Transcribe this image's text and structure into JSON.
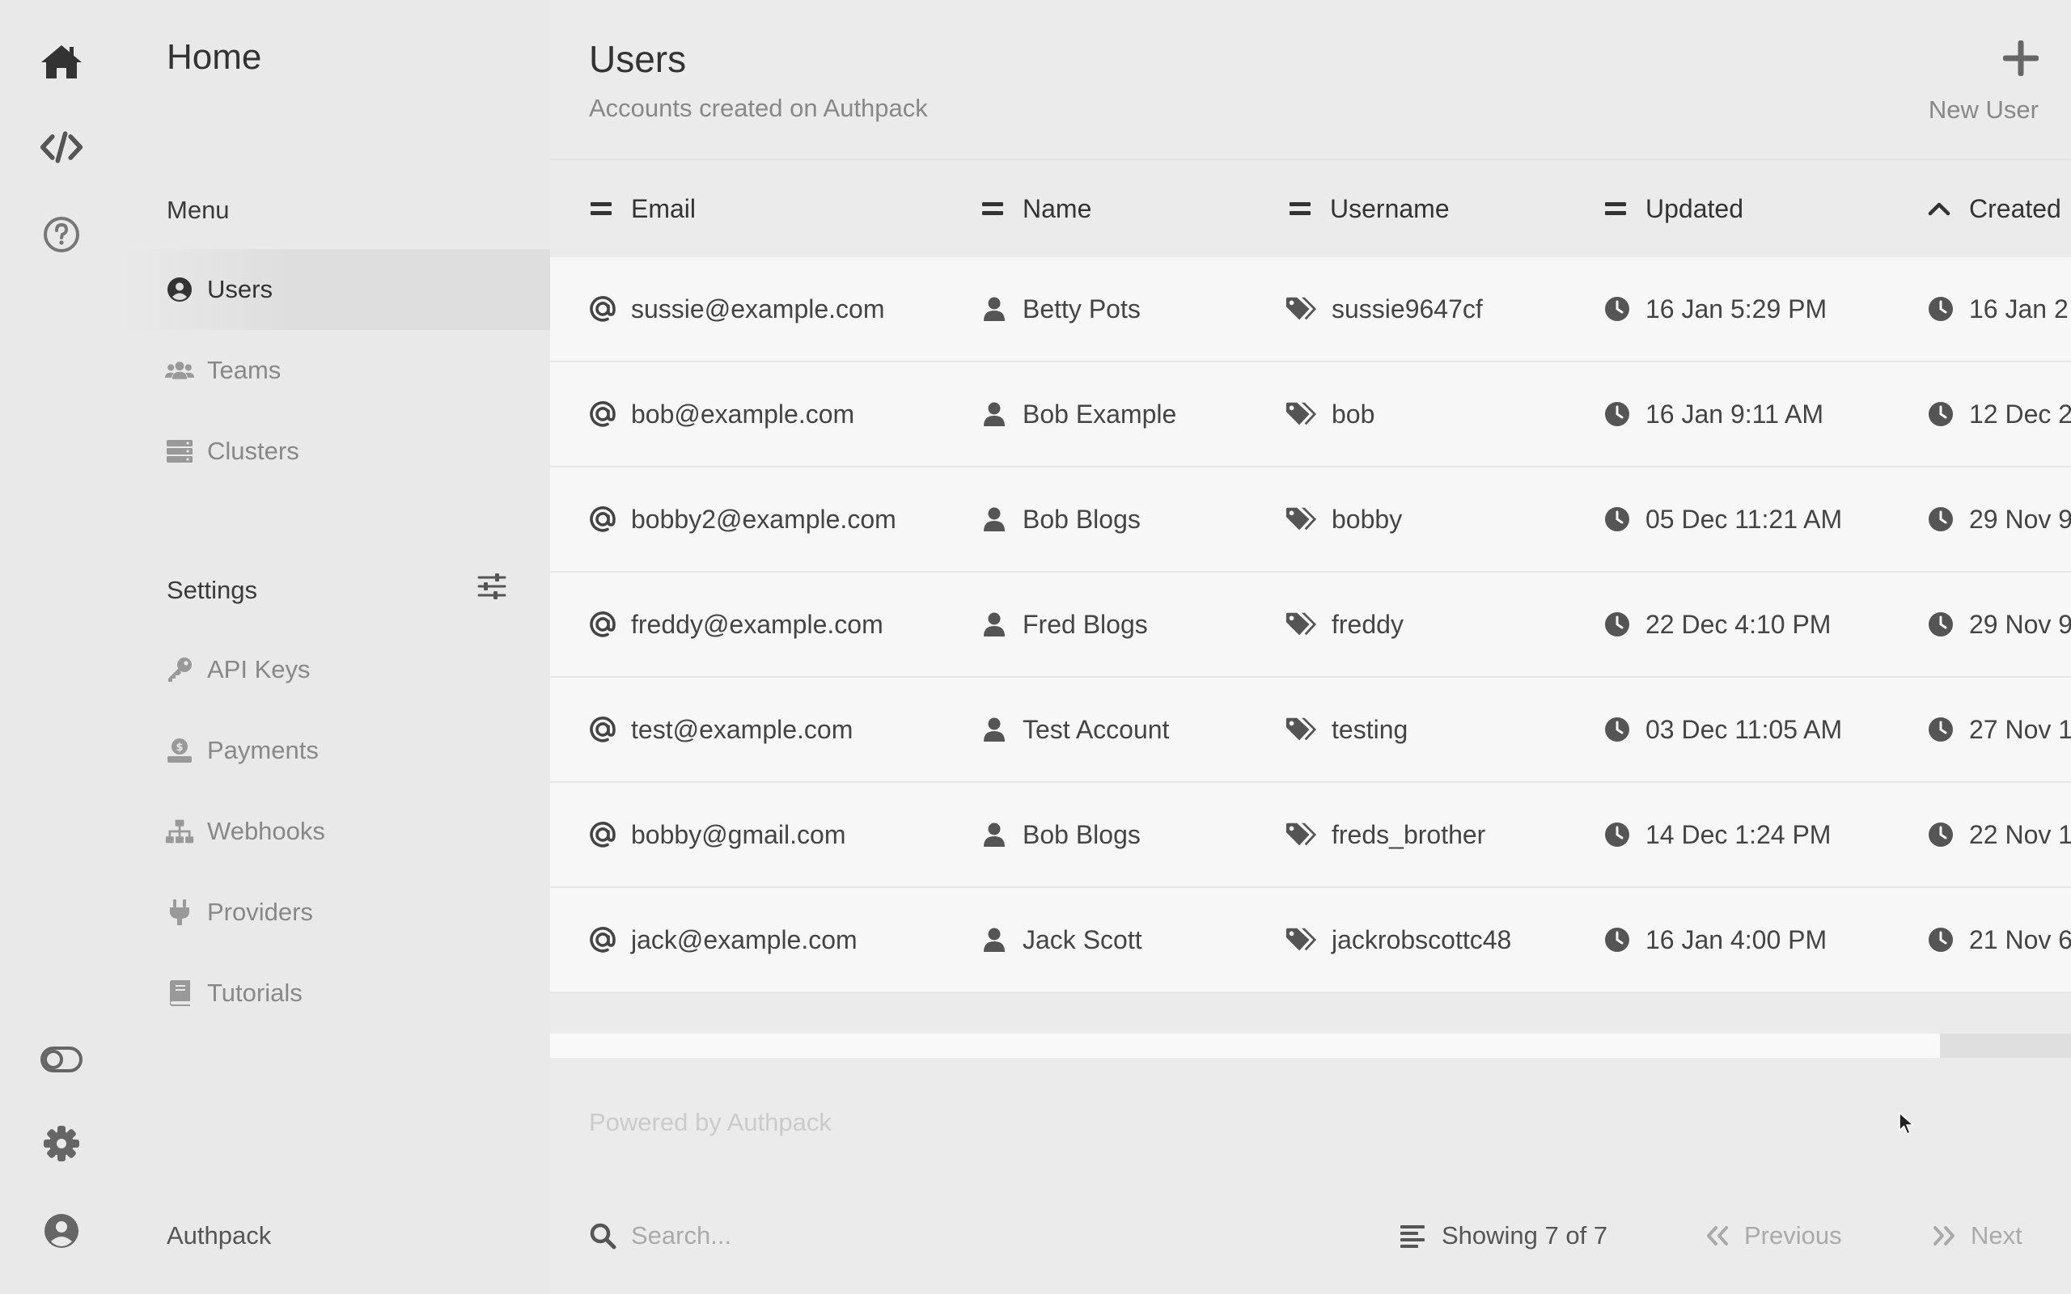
{
  "rail": {
    "top_icons": [
      "home-icon",
      "code-icon",
      "help-icon"
    ],
    "bottom_icons": [
      "theme-toggle-icon",
      "settings-gear-icon",
      "account-icon"
    ]
  },
  "nav": {
    "title": "Home",
    "menu_heading": "Menu",
    "menu_items": [
      {
        "label": "Users",
        "icon": "user-circle-icon",
        "active": true
      },
      {
        "label": "Teams",
        "icon": "users-group-icon",
        "active": false
      },
      {
        "label": "Clusters",
        "icon": "server-stack-icon",
        "active": false
      }
    ],
    "settings_heading": "Settings",
    "settings_items": [
      {
        "label": "API Keys",
        "icon": "key-icon"
      },
      {
        "label": "Payments",
        "icon": "payment-icon"
      },
      {
        "label": "Webhooks",
        "icon": "sitemap-icon"
      },
      {
        "label": "Providers",
        "icon": "plug-icon"
      },
      {
        "label": "Tutorials",
        "icon": "book-icon"
      }
    ],
    "brand": "Authpack"
  },
  "main": {
    "title": "Users",
    "subtitle": "Accounts created on Authpack",
    "new_user_label": "New User",
    "columns": [
      {
        "label": "Email",
        "sort": "none"
      },
      {
        "label": "Name",
        "sort": "none"
      },
      {
        "label": "Username",
        "sort": "none"
      },
      {
        "label": "Updated",
        "sort": "none"
      },
      {
        "label": "Created",
        "sort": "ascending"
      }
    ],
    "rows": [
      {
        "email": "sussie@example.com",
        "name": "Betty Pots",
        "username": "sussie9647cf",
        "updated": "16 Jan 5:29 PM",
        "created": "16 Jan 2"
      },
      {
        "email": "bob@example.com",
        "name": "Bob Example",
        "username": "bob",
        "updated": "16 Jan 9:11 AM",
        "created": "12 Dec 2"
      },
      {
        "email": "bobby2@example.com",
        "name": "Bob Blogs",
        "username": "bobby",
        "updated": "05 Dec 11:21 AM",
        "created": "29 Nov 9"
      },
      {
        "email": "freddy@example.com",
        "name": "Fred Blogs",
        "username": "freddy",
        "updated": "22 Dec 4:10 PM",
        "created": "29 Nov 9"
      },
      {
        "email": "test@example.com",
        "name": "Test Account",
        "username": "testing",
        "updated": "03 Dec 11:05 AM",
        "created": "27 Nov 1"
      },
      {
        "email": "bobby@gmail.com",
        "name": "Bob Blogs",
        "username": "freds_brother",
        "updated": "14 Dec 1:24 PM",
        "created": "22 Nov 1"
      },
      {
        "email": "jack@example.com",
        "name": "Jack Scott",
        "username": "jackrobscottc48",
        "updated": "16 Jan 4:00 PM",
        "created": "21 Nov 6"
      }
    ],
    "powered_by": "Powered by Authpack"
  },
  "footer": {
    "search_placeholder": "Search...",
    "search_value": "",
    "showing": "Showing 7 of 7",
    "previous_label": "Previous",
    "next_label": "Next"
  },
  "colors": {
    "background": "#ebebeb",
    "table_bg": "#f7f7f7",
    "text_primary": "#333333",
    "text_muted": "#888888",
    "text_faint": "#aaaaaa"
  }
}
